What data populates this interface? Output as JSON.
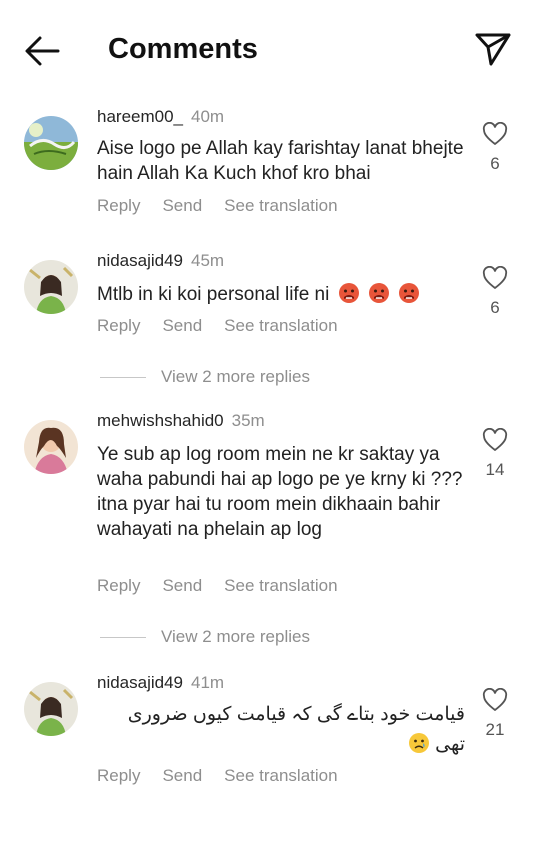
{
  "header": {
    "title": "Comments",
    "back_icon": "arrow-left-icon",
    "share_icon": "paper-plane-icon"
  },
  "actions": {
    "reply": "Reply",
    "send": "Send",
    "see_translation": "See translation"
  },
  "comments": [
    {
      "username": "hareem00_",
      "time": "40m",
      "text": "Aise logo pe Allah kay farishtay lanat bhejte hain Allah Ka Kuch khof kro bhai",
      "likes": "6"
    },
    {
      "username": "nidasajid49",
      "time": "45m",
      "text": "Mtlb in ki koi personal life ni",
      "emoji": [
        "angry-hot-face-emoji",
        "angry-hot-face-emoji",
        "angry-hot-face-emoji"
      ],
      "likes": "6",
      "more_replies": "View 2 more replies"
    },
    {
      "username": "mehwishshahid0",
      "time": "35m",
      "text": "Ye sub ap log room mein ne kr saktay ya waha pabundi hai ap logo pe ye krny ki ??? itna pyar hai tu room mein dikhaain bahir wahayati na phelain ap log",
      "likes": "14",
      "more_replies": "View 2 more replies"
    },
    {
      "username": "nidasajid49",
      "time": "41m",
      "text": "قیامت خود بتاے گی کہ قیامت کیوں ضروری تھی",
      "emoji": [
        "crying-face-emoji"
      ],
      "likes": "21"
    }
  ],
  "colors": {
    "text": "#222222",
    "muted": "#8e8e8e",
    "background": "#ffffff"
  }
}
